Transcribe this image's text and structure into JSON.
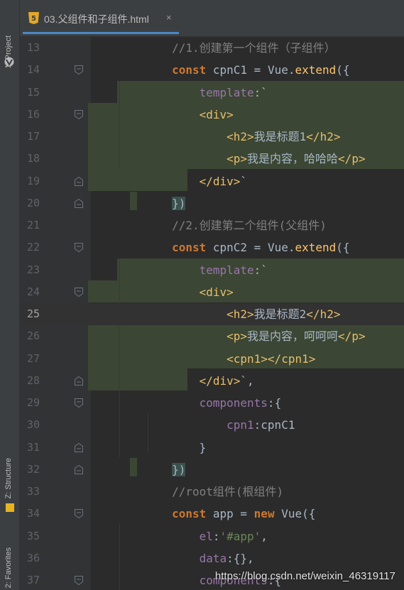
{
  "side_strip": {
    "project_tab": "1: Project",
    "structure_tab": "Z: Structure",
    "favorites_tab": "2: Favorites"
  },
  "tab": {
    "icon": "html5-icon",
    "title": "03.父组件和子组件.html",
    "close": "×"
  },
  "editor": {
    "current_line": 25,
    "lines": [
      {
        "n": "13",
        "fold": "",
        "tokens": [
          {
            "t": "        ",
            "c": "txt"
          },
          {
            "t": "//1.创建第一个组件（子组件）",
            "c": "cm"
          }
        ]
      },
      {
        "n": "14",
        "fold": "open",
        "tokens": [
          {
            "t": "        ",
            "c": "txt"
          },
          {
            "t": "const",
            "c": "kw"
          },
          {
            "t": " cpnC1 = ",
            "c": "txt"
          },
          {
            "t": "Vue",
            "c": "cls"
          },
          {
            "t": ".",
            "c": "txt"
          },
          {
            "t": "extend",
            "c": "fn"
          },
          {
            "t": "({",
            "c": "brk"
          }
        ]
      },
      {
        "n": "15",
        "fold": "",
        "tokens": [
          {
            "t": "            ",
            "c": "txt"
          },
          {
            "t": "template",
            "c": "prop"
          },
          {
            "t": ":`",
            "c": "txt"
          }
        ]
      },
      {
        "n": "16",
        "fold": "open",
        "tokens": [
          {
            "t": "            ",
            "c": "txt"
          },
          {
            "t": "<div>",
            "c": "tag"
          }
        ]
      },
      {
        "n": "17",
        "fold": "",
        "tokens": [
          {
            "t": "                ",
            "c": "txt"
          },
          {
            "t": "<h2>",
            "c": "tag"
          },
          {
            "t": "我是标题1",
            "c": "txt"
          },
          {
            "t": "</h2>",
            "c": "tag"
          }
        ]
      },
      {
        "n": "18",
        "fold": "",
        "tokens": [
          {
            "t": "                ",
            "c": "txt"
          },
          {
            "t": "<p>",
            "c": "tag"
          },
          {
            "t": "我是内容，哈哈哈",
            "c": "txt"
          },
          {
            "t": "</p>",
            "c": "tag"
          }
        ]
      },
      {
        "n": "19",
        "fold": "close",
        "tokens": [
          {
            "t": "            ",
            "c": "txt"
          },
          {
            "t": "</div>",
            "c": "tag"
          },
          {
            "t": "`",
            "c": "txt"
          }
        ]
      },
      {
        "n": "20",
        "fold": "close",
        "tokens": [
          {
            "t": "        ",
            "c": "txt"
          },
          {
            "t": "})",
            "c": "brkm"
          }
        ]
      },
      {
        "n": "21",
        "fold": "",
        "tokens": [
          {
            "t": "        ",
            "c": "txt"
          },
          {
            "t": "//2.创建第二个组件(父组件)",
            "c": "cm"
          }
        ]
      },
      {
        "n": "22",
        "fold": "open",
        "tokens": [
          {
            "t": "        ",
            "c": "txt"
          },
          {
            "t": "const",
            "c": "kw"
          },
          {
            "t": " cpnC2 = ",
            "c": "txt"
          },
          {
            "t": "Vue",
            "c": "cls"
          },
          {
            "t": ".",
            "c": "txt"
          },
          {
            "t": "extend",
            "c": "fn"
          },
          {
            "t": "({",
            "c": "brk"
          }
        ]
      },
      {
        "n": "23",
        "fold": "",
        "tokens": [
          {
            "t": "            ",
            "c": "txt"
          },
          {
            "t": "template",
            "c": "prop"
          },
          {
            "t": ":`",
            "c": "txt"
          }
        ]
      },
      {
        "n": "24",
        "fold": "open",
        "tokens": [
          {
            "t": "            ",
            "c": "txt"
          },
          {
            "t": "<div>",
            "c": "tag"
          }
        ]
      },
      {
        "n": "25",
        "fold": "",
        "tokens": [
          {
            "t": "                ",
            "c": "txt"
          },
          {
            "t": "<h2>",
            "c": "tag"
          },
          {
            "t": "我是标题2",
            "c": "txt"
          },
          {
            "t": "</h2>",
            "c": "tag"
          }
        ]
      },
      {
        "n": "26",
        "fold": "",
        "tokens": [
          {
            "t": "                ",
            "c": "txt"
          },
          {
            "t": "<p>",
            "c": "tag"
          },
          {
            "t": "我是内容，呵呵呵",
            "c": "txt"
          },
          {
            "t": "</p>",
            "c": "tag"
          }
        ]
      },
      {
        "n": "27",
        "fold": "",
        "tokens": [
          {
            "t": "                ",
            "c": "txt"
          },
          {
            "t": "<cpn1>",
            "c": "tag"
          },
          {
            "t": "</cpn1>",
            "c": "tag"
          }
        ]
      },
      {
        "n": "28",
        "fold": "close",
        "tokens": [
          {
            "t": "            ",
            "c": "txt"
          },
          {
            "t": "</div>",
            "c": "tag"
          },
          {
            "t": "`,",
            "c": "txt"
          }
        ]
      },
      {
        "n": "29",
        "fold": "open",
        "tokens": [
          {
            "t": "            ",
            "c": "txt"
          },
          {
            "t": "components",
            "c": "prop"
          },
          {
            "t": ":",
            "c": "txt"
          },
          {
            "t": "{",
            "c": "brk"
          }
        ]
      },
      {
        "n": "30",
        "fold": "",
        "tokens": [
          {
            "t": "                ",
            "c": "txt"
          },
          {
            "t": "cpn1",
            "c": "prop"
          },
          {
            "t": ":cpnC1",
            "c": "txt"
          }
        ]
      },
      {
        "n": "31",
        "fold": "close",
        "tokens": [
          {
            "t": "            ",
            "c": "txt"
          },
          {
            "t": "}",
            "c": "brk"
          }
        ]
      },
      {
        "n": "32",
        "fold": "close",
        "tokens": [
          {
            "t": "        ",
            "c": "txt"
          },
          {
            "t": "})",
            "c": "brkm"
          }
        ]
      },
      {
        "n": "33",
        "fold": "",
        "tokens": [
          {
            "t": "        ",
            "c": "txt"
          },
          {
            "t": "//root组件(根组件)",
            "c": "cm"
          }
        ]
      },
      {
        "n": "34",
        "fold": "open",
        "tokens": [
          {
            "t": "        ",
            "c": "txt"
          },
          {
            "t": "const",
            "c": "kw"
          },
          {
            "t": " app = ",
            "c": "txt"
          },
          {
            "t": "new",
            "c": "kw"
          },
          {
            "t": " ",
            "c": "txt"
          },
          {
            "t": "Vue",
            "c": "cls"
          },
          {
            "t": "({",
            "c": "brk"
          }
        ]
      },
      {
        "n": "35",
        "fold": "",
        "tokens": [
          {
            "t": "            ",
            "c": "txt"
          },
          {
            "t": "el",
            "c": "prop"
          },
          {
            "t": ":",
            "c": "txt"
          },
          {
            "t": "'#app'",
            "c": "str"
          },
          {
            "t": ",",
            "c": "txt"
          }
        ]
      },
      {
        "n": "36",
        "fold": "",
        "tokens": [
          {
            "t": "            ",
            "c": "txt"
          },
          {
            "t": "data",
            "c": "prop"
          },
          {
            "t": ":",
            "c": "txt"
          },
          {
            "t": "{}",
            "c": "brk"
          },
          {
            "t": ",",
            "c": "txt"
          }
        ]
      },
      {
        "n": "37",
        "fold": "open",
        "tokens": [
          {
            "t": "            ",
            "c": "txt"
          },
          {
            "t": "components",
            "c": "prop"
          },
          {
            "t": ":{",
            "c": "txt"
          }
        ]
      }
    ]
  },
  "watermark": "https://blog.csdn.net/weixin_46319117",
  "colors": {
    "background": "#2b2b2b",
    "keyword": "#cc7832",
    "tag": "#e8bf6a",
    "property": "#9876aa",
    "comment": "#808080",
    "function": "#ffc66d",
    "injected_highlight": "#3b4634"
  }
}
